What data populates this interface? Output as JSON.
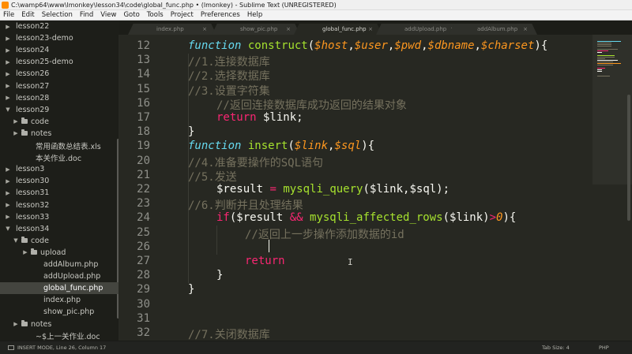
{
  "window": {
    "title": "C:\\wamp64\\www\\lmonkey\\lesson34\\code\\global_func.php • (lmonkey) - Sublime Text (UNREGISTERED)"
  },
  "menu": [
    "File",
    "Edit",
    "Selection",
    "Find",
    "View",
    "Goto",
    "Tools",
    "Project",
    "Preferences",
    "Help"
  ],
  "sidebar": {
    "items": [
      {
        "label": "lesson22",
        "depth": 1,
        "type": "folder",
        "expanded": false
      },
      {
        "label": "lesson23-demo",
        "depth": 1,
        "type": "folder",
        "expanded": false
      },
      {
        "label": "lesson24",
        "depth": 1,
        "type": "folder",
        "expanded": false
      },
      {
        "label": "lesson25-demo",
        "depth": 1,
        "type": "folder",
        "expanded": false
      },
      {
        "label": "lesson26",
        "depth": 1,
        "type": "folder",
        "expanded": false
      },
      {
        "label": "lesson27",
        "depth": 1,
        "type": "folder",
        "expanded": false
      },
      {
        "label": "lesson28",
        "depth": 1,
        "type": "folder",
        "expanded": false
      },
      {
        "label": "lesson29",
        "depth": 1,
        "type": "folder",
        "expanded": true
      },
      {
        "label": "code",
        "depth": 2,
        "type": "folder",
        "expanded": false
      },
      {
        "label": "notes",
        "depth": 2,
        "type": "folder",
        "expanded": false
      },
      {
        "label": "常用函数总结表.xls",
        "depth": 2,
        "type": "file"
      },
      {
        "label": "本关作业.doc",
        "depth": 2,
        "type": "file"
      },
      {
        "label": "lesson3",
        "depth": 1,
        "type": "folder",
        "expanded": false
      },
      {
        "label": "lesson30",
        "depth": 1,
        "type": "folder",
        "expanded": false
      },
      {
        "label": "lesson31",
        "depth": 1,
        "type": "folder",
        "expanded": false
      },
      {
        "label": "lesson32",
        "depth": 1,
        "type": "folder",
        "expanded": false
      },
      {
        "label": "lesson33",
        "depth": 1,
        "type": "folder",
        "expanded": false
      },
      {
        "label": "lesson34",
        "depth": 1,
        "type": "folder",
        "expanded": true
      },
      {
        "label": "code",
        "depth": 2,
        "type": "folder",
        "expanded": true
      },
      {
        "label": "upload",
        "depth": 3,
        "type": "folder",
        "expanded": false
      },
      {
        "label": "addAlbum.php",
        "depth": 3,
        "type": "file"
      },
      {
        "label": "addUpload.php",
        "depth": 3,
        "type": "file"
      },
      {
        "label": "global_func.php",
        "depth": 3,
        "type": "file",
        "active": true
      },
      {
        "label": "index.php",
        "depth": 3,
        "type": "file"
      },
      {
        "label": "show_pic.php",
        "depth": 3,
        "type": "file"
      },
      {
        "label": "notes",
        "depth": 2,
        "type": "folder",
        "expanded": false
      },
      {
        "label": "~$上一关作业.doc",
        "depth": 2,
        "type": "file"
      }
    ]
  },
  "tabs": [
    {
      "label": "index.php",
      "active": false
    },
    {
      "label": "show_pic.php",
      "active": false
    },
    {
      "label": "global_func.php",
      "active": true
    },
    {
      "label": "addUpload.php",
      "active": false
    },
    {
      "label": "addAlbum.php",
      "active": false
    }
  ],
  "editor": {
    "cursor": {
      "line": 26,
      "column": 17
    },
    "lines": [
      {
        "n": "12",
        "tokens": [
          [
            "",
            "\t"
          ],
          [
            "kw",
            "function"
          ],
          [
            "",
            " "
          ],
          [
            "fn",
            "construct"
          ],
          [
            "",
            "("
          ],
          [
            "param",
            "$host"
          ],
          [
            "",
            ","
          ],
          [
            "param",
            "$user"
          ],
          [
            "",
            ","
          ],
          [
            "param",
            "$pwd"
          ],
          [
            "",
            ","
          ],
          [
            "param",
            "$dbname"
          ],
          [
            "",
            ","
          ],
          [
            "param",
            "$charset"
          ],
          [
            "",
            "){"
          ]
        ]
      },
      {
        "n": "13",
        "tokens": [
          [
            "",
            "\t"
          ],
          [
            "cm",
            "//1.连接数据库"
          ]
        ]
      },
      {
        "n": "14",
        "tokens": [
          [
            "",
            "\t"
          ],
          [
            "cm",
            "//2.选择数据库"
          ]
        ]
      },
      {
        "n": "15",
        "tokens": [
          [
            "",
            "\t"
          ],
          [
            "cm",
            "//3.设置字符集"
          ]
        ]
      },
      {
        "n": "16",
        "tokens": [
          [
            "",
            "\t\t"
          ],
          [
            "cm",
            "//返回连接数据库成功返回的结果对象"
          ]
        ]
      },
      {
        "n": "17",
        "tokens": [
          [
            "",
            "\t\t"
          ],
          [
            "ctrl",
            "return"
          ],
          [
            "",
            " $link;"
          ]
        ]
      },
      {
        "n": "18",
        "tokens": [
          [
            "",
            "\t}"
          ]
        ]
      },
      {
        "n": "19",
        "tokens": [
          [
            "",
            "\t"
          ],
          [
            "kw",
            "function"
          ],
          [
            "",
            " "
          ],
          [
            "fn",
            "insert"
          ],
          [
            "",
            "("
          ],
          [
            "param",
            "$link"
          ],
          [
            "",
            ","
          ],
          [
            "param",
            "$sql"
          ],
          [
            "",
            "){"
          ]
        ]
      },
      {
        "n": "20",
        "tokens": [
          [
            "",
            "\t"
          ],
          [
            "cm",
            "//4.准备要操作的SQL语句"
          ]
        ]
      },
      {
        "n": "21",
        "tokens": [
          [
            "",
            "\t"
          ],
          [
            "cm",
            "//5.发送"
          ]
        ]
      },
      {
        "n": "22",
        "tokens": [
          [
            "",
            "\t\t$result "
          ],
          [
            "ctrl",
            "="
          ],
          [
            "",
            " "
          ],
          [
            "fn",
            "mysqli_query"
          ],
          [
            "",
            "($link,$sql);"
          ]
        ]
      },
      {
        "n": "23",
        "tokens": [
          [
            "",
            "\t"
          ],
          [
            "cm",
            "//6.判断并且处理结果"
          ]
        ]
      },
      {
        "n": "24",
        "tokens": [
          [
            "",
            "\t\t"
          ],
          [
            "ctrl",
            "if"
          ],
          [
            "",
            "($result "
          ],
          [
            "ctrl",
            "&&"
          ],
          [
            "",
            " "
          ],
          [
            "fn",
            "mysqli_affected_rows"
          ],
          [
            "",
            "($link)"
          ],
          [
            "ctrl",
            ">"
          ],
          [
            "param",
            "0"
          ],
          [
            "",
            "){"
          ]
        ]
      },
      {
        "n": "25",
        "tokens": [
          [
            "",
            "\t\t\t"
          ],
          [
            "cm",
            "//返回上一步操作添加数据的id"
          ]
        ]
      },
      {
        "n": "26",
        "tokens": [
          [
            "",
            "\t\t\t"
          ]
        ]
      },
      {
        "n": "27",
        "tokens": [
          [
            "",
            "\t\t\t"
          ],
          [
            "ctrl",
            "return"
          ]
        ]
      },
      {
        "n": "28",
        "tokens": [
          [
            "",
            "\t\t}"
          ]
        ]
      },
      {
        "n": "29",
        "tokens": [
          [
            "",
            "\t}"
          ]
        ]
      },
      {
        "n": "30",
        "tokens": []
      },
      {
        "n": "31",
        "tokens": []
      },
      {
        "n": "32",
        "tokens": [
          [
            "",
            "\t"
          ],
          [
            "cm",
            "//7.关闭数据库"
          ]
        ]
      }
    ]
  },
  "statusbar": {
    "mode": "INSERT MODE, Line 26, Column 17",
    "tab_size": "Tab Size: 4",
    "syntax": "PHP"
  },
  "colors": {
    "background": "#272822",
    "sidebar": "#1d1e19",
    "keyword": "#66d9ef",
    "function": "#a6e22e",
    "parameter": "#fd971f",
    "comment": "#75715e",
    "operator": "#f92672"
  }
}
